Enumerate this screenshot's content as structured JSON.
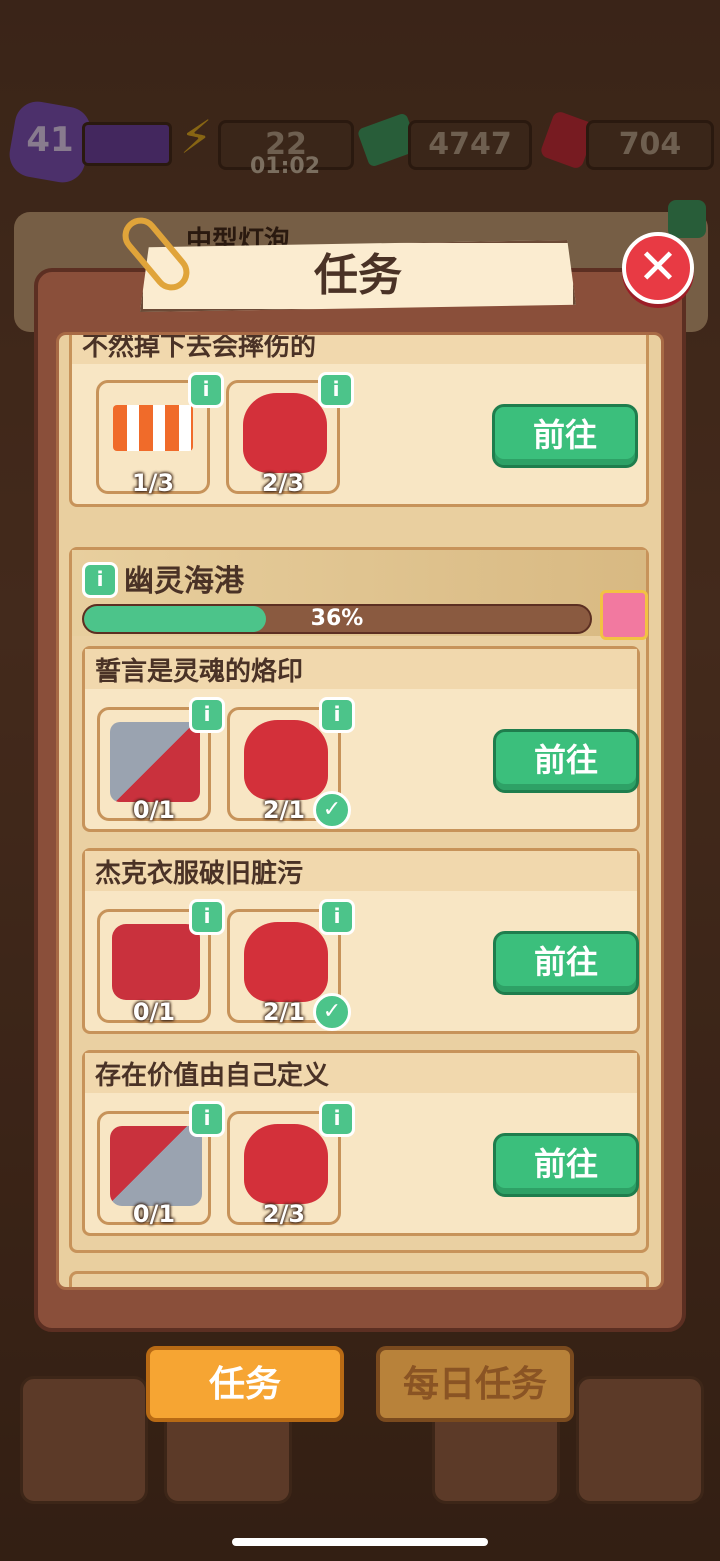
{
  "hud": {
    "level": "41",
    "energy": "22",
    "energy_timer": "01:02",
    "cash": "4747",
    "gems": "704"
  },
  "behind_panel_text": "中型灯泡",
  "panel": {
    "title": "任务",
    "tasks_top": [
      {
        "title": "不然掉下去会摔伤的",
        "items": [
          {
            "icon": "barricade-icon",
            "count": "1/3"
          },
          {
            "icon": "gloves-icon",
            "count": "2/3"
          }
        ],
        "button": "前往"
      }
    ],
    "section": {
      "name": "幽灵海港",
      "progress_label": "36%",
      "progress": 0.36
    },
    "tasks": [
      {
        "title": "誓言是灵魂的烙印",
        "items": [
          {
            "icon": "saw-icon",
            "count": "0/1"
          },
          {
            "icon": "gloves-icon",
            "count": "2/1",
            "done": true
          }
        ],
        "button": "前往"
      },
      {
        "title": "杰克衣服破旧脏污",
        "items": [
          {
            "icon": "sander-icon",
            "count": "0/1"
          },
          {
            "icon": "gloves-icon",
            "count": "2/1",
            "done": true
          }
        ],
        "button": "前往"
      },
      {
        "title": "存在价值由自己定义",
        "items": [
          {
            "icon": "chainsaw-icon",
            "count": "0/1"
          },
          {
            "icon": "gloves-icon",
            "count": "2/3"
          }
        ],
        "button": "前往"
      }
    ]
  },
  "tabs": {
    "tasks": "任务",
    "daily": "每日任务"
  },
  "colors": {
    "accent_green": "#3bbf7c",
    "tab_active": "#f6a533",
    "close_red": "#e83a44"
  }
}
